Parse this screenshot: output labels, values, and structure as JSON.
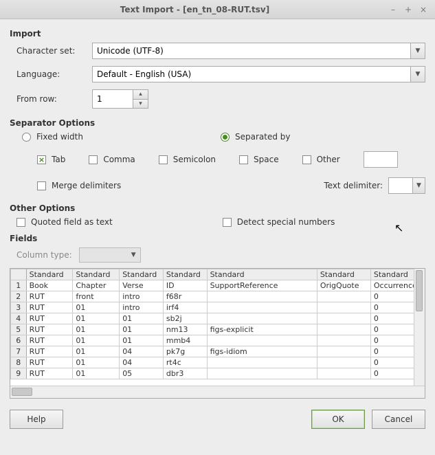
{
  "window": {
    "title": "Text Import - [en_tn_08-RUT.tsv]"
  },
  "import": {
    "heading": "Import",
    "charset_label": "Character set:",
    "charset_value": "Unicode (UTF-8)",
    "language_label": "Language:",
    "language_value": "Default - English (USA)",
    "fromrow_label": "From row:",
    "fromrow_value": "1"
  },
  "separator": {
    "heading": "Separator Options",
    "fixed_label": "Fixed width",
    "separated_label": "Separated by",
    "tab_label": "Tab",
    "comma_label": "Comma",
    "semicolon_label": "Semicolon",
    "space_label": "Space",
    "other_label": "Other",
    "merge_label": "Merge delimiters",
    "textdelim_label": "Text delimiter:",
    "textdelim_value": ""
  },
  "other": {
    "heading": "Other Options",
    "quoted_label": "Quoted field as text",
    "detect_label": "Detect special numbers"
  },
  "fields": {
    "heading": "Fields",
    "coltype_label": "Column type:",
    "col_header": "Standard",
    "columns": [
      "Standard",
      "Standard",
      "Standard",
      "Standard",
      "Standard",
      "Standard",
      "Standard"
    ],
    "widths": [
      66,
      66,
      62,
      62,
      156,
      76,
      76
    ],
    "rows": [
      [
        "Book",
        "Chapter",
        "Verse",
        "ID",
        "SupportReference",
        "OrigQuote",
        "Occurrence"
      ],
      [
        "RUT",
        "front",
        "intro",
        "f68r",
        "",
        "",
        "0"
      ],
      [
        "RUT",
        "01",
        "intro",
        "irf4",
        "",
        "",
        "0"
      ],
      [
        "RUT",
        "01",
        "01",
        "sb2j",
        "",
        "",
        "0"
      ],
      [
        "RUT",
        "01",
        "01",
        "nm13",
        "figs-explicit",
        "",
        "0"
      ],
      [
        "RUT",
        "01",
        "01",
        "mmb4",
        "",
        "",
        "0"
      ],
      [
        "RUT",
        "01",
        "04",
        "pk7g",
        "figs-idiom",
        "",
        "0"
      ],
      [
        "RUT",
        "01",
        "04",
        "rt4c",
        "",
        "",
        "0"
      ],
      [
        "RUT",
        "01",
        "05",
        "dbr3",
        "",
        "",
        "0"
      ]
    ]
  },
  "buttons": {
    "help": "Help",
    "ok": "OK",
    "cancel": "Cancel"
  }
}
